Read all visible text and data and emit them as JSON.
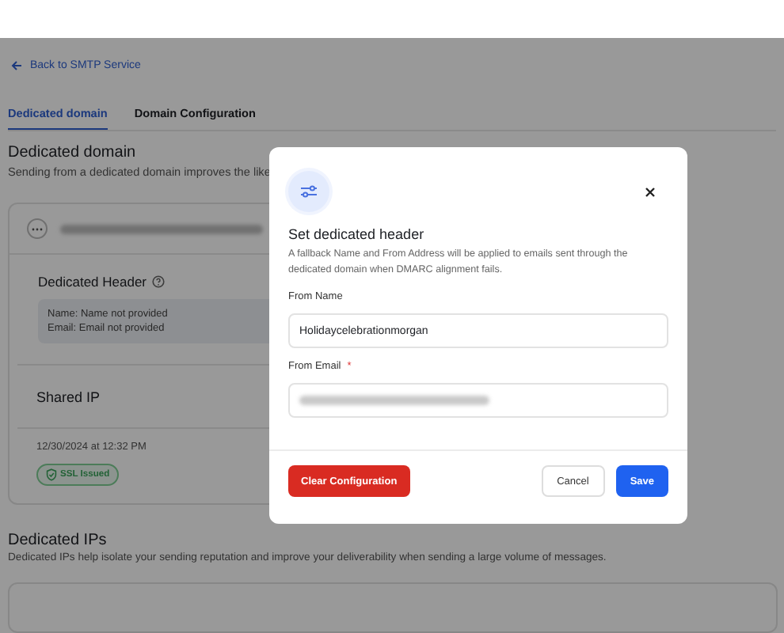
{
  "back_link": {
    "label": "Back to SMTP Service"
  },
  "tabs": [
    {
      "label": "Dedicated domain",
      "selected": true
    },
    {
      "label": "Domain Configuration",
      "selected": false
    }
  ],
  "section": {
    "title": "Dedicated domain",
    "subtitle": "Sending from a dedicated domain improves the like"
  },
  "domain_card": {
    "header_title": "Dedicated Header",
    "header_info": [
      {
        "label": "Name:",
        "value": "Name not provided"
      },
      {
        "label": "Email:",
        "value": "Email not provided"
      }
    ],
    "shared_ip_title": "Shared IP",
    "date": "12/30/2024 at 12:32 PM",
    "ssl_badge": "SSL Issued"
  },
  "ips_section": {
    "title": "Dedicated IPs",
    "text": "Dedicated IPs help isolate your sending reputation and improve your deliverability when sending a large volume of messages."
  },
  "modal": {
    "title": "Set dedicated header",
    "description": "A fallback Name and From Address will be applied to emails sent through the dedicated domain when DMARC alignment fails.",
    "fields": [
      {
        "label": "From Name",
        "kind": "text",
        "value": "Holidaycelebrationmorgan"
      },
      {
        "label": "From Email",
        "required_mark": "*",
        "kind": "redacted"
      }
    ],
    "buttons": [
      {
        "label": "Clear Configuration",
        "kind": "danger"
      },
      {
        "label": "Cancel",
        "kind": "secondary"
      },
      {
        "label": "Save",
        "kind": "primary"
      }
    ]
  }
}
